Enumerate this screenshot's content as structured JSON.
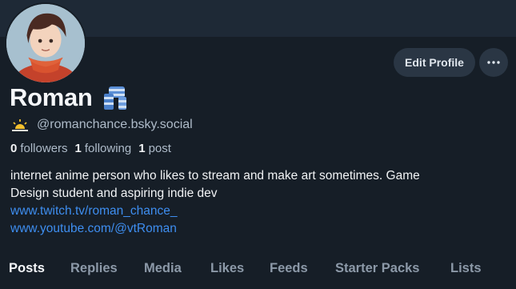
{
  "profile": {
    "display_name": "Roman",
    "name_emoji": "scarf-emoji",
    "handle_icon": "sunrise-icon",
    "handle": "@romanchance.bsky.social",
    "followers_count": "0",
    "followers_label": "followers",
    "following_count": "1",
    "following_label": "following",
    "posts_count": "1",
    "posts_label": "post",
    "bio_line1": "internet anime person who likes to stream and make art sometimes. Game",
    "bio_line2": "Design student and aspiring indie dev",
    "link_twitch": "www.twitch.tv/roman_chance_",
    "link_youtube": "www.youtube.com/@vtRoman"
  },
  "actions": {
    "edit_profile": "Edit Profile",
    "more_icon": "ellipsis-icon"
  },
  "tabs": [
    {
      "label": "Posts",
      "active": true
    },
    {
      "label": "Replies"
    },
    {
      "label": "Media"
    },
    {
      "label": "Likes"
    },
    {
      "label": "Feeds"
    },
    {
      "label": "Starter Packs"
    },
    {
      "label": "Lists"
    }
  ],
  "colors": {
    "background": "#161e27",
    "banner": "#1e2936",
    "link": "#3e8ef0",
    "muted_text": "#aebbc9",
    "button_bg": "#2a3644"
  }
}
